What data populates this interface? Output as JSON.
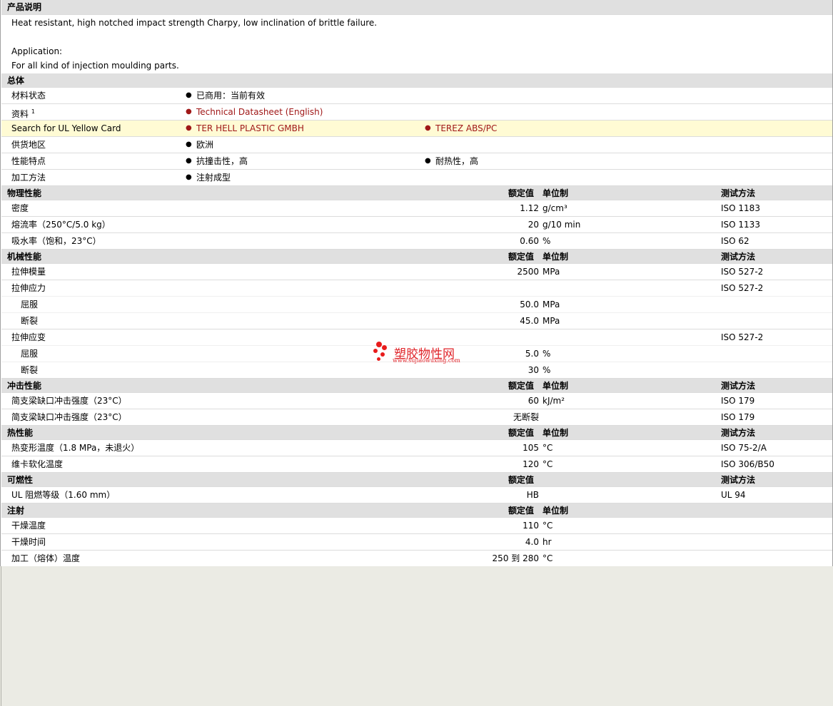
{
  "sections": {
    "description": "产品说明",
    "general": "总体",
    "physical": "物理性能",
    "mechanical": "机械性能",
    "impact": "冲击性能",
    "thermal": "热性能",
    "flammability": "可燃性",
    "injection": "注射"
  },
  "col_headers": {
    "nominal": "额定值",
    "unit": "单位制",
    "method": "测试方法"
  },
  "description": {
    "line1": "Heat resistant, high notched impact strength Charpy, low inclination of brittle failure.",
    "line2": "Application:",
    "line3": "For all kind of injection moulding parts."
  },
  "general": {
    "status_label": "材料状态",
    "status_value": "已商用：当前有效",
    "docs_label": "资料",
    "docs_sup": "1",
    "docs_value": "Technical Datasheet (English)",
    "ul_label": "Search for UL Yellow Card",
    "ul_value1": "TER HELL PLASTIC GMBH",
    "ul_value2": "TEREZ ABS/PC",
    "region_label": "供货地区",
    "region_value": "欧洲",
    "features_label": "性能特点",
    "features_value1": "抗撞击性，高",
    "features_value2": "耐热性，高",
    "process_label": "加工方法",
    "process_value": "注射成型"
  },
  "physical": [
    {
      "name": "密度",
      "value": "1.12",
      "unit": "g/cm³",
      "method": "ISO 1183"
    },
    {
      "name": "熔流率（250°C/5.0 kg）",
      "value": "20",
      "unit": "g/10 min",
      "method": "ISO 1133"
    },
    {
      "name": "吸水率（饱和，23°C）",
      "value": "0.60",
      "unit": "%",
      "method": "ISO 62"
    }
  ],
  "mechanical": {
    "modulus": {
      "name": "拉伸模量",
      "value": "2500",
      "unit": "MPa",
      "method": "ISO 527-2"
    },
    "stress": {
      "name": "拉伸应力",
      "method": "ISO 527-2"
    },
    "stress_yield": {
      "name": "屈服",
      "value": "50.0",
      "unit": "MPa"
    },
    "stress_break": {
      "name": "断裂",
      "value": "45.0",
      "unit": "MPa"
    },
    "strain": {
      "name": "拉伸应变",
      "method": "ISO 527-2"
    },
    "strain_yield": {
      "name": "屈服",
      "value": "5.0",
      "unit": "%"
    },
    "strain_break": {
      "name": "断裂",
      "value": "30",
      "unit": "%"
    }
  },
  "impact": [
    {
      "name": "简支梁缺口冲击强度（23°C）",
      "value": "60",
      "unit": "kJ/m²",
      "method": "ISO 179"
    },
    {
      "name": "简支梁缺口冲击强度（23°C）",
      "value": "无断裂",
      "unit": "",
      "method": "ISO 179"
    }
  ],
  "thermal": [
    {
      "name": "热变形温度（1.8 MPa，未退火）",
      "value": "105",
      "unit": "°C",
      "method": "ISO 75-2/A"
    },
    {
      "name": "维卡软化温度",
      "value": "120",
      "unit": "°C",
      "method": "ISO 306/B50"
    }
  ],
  "flammability": [
    {
      "name": "UL 阻燃等级（1.60 mm）",
      "value": "HB",
      "unit": "",
      "method": "UL 94"
    }
  ],
  "injection": [
    {
      "name": "干燥温度",
      "value": "110",
      "unit": "°C"
    },
    {
      "name": "干燥时间",
      "value": "4.0",
      "unit": "hr"
    },
    {
      "name": "加工（熔体）温度",
      "value": "250 到 280",
      "unit": "°C"
    }
  ],
  "watermark": {
    "title": "塑胶物性网",
    "url": "www.sujiaowuxing.com"
  }
}
